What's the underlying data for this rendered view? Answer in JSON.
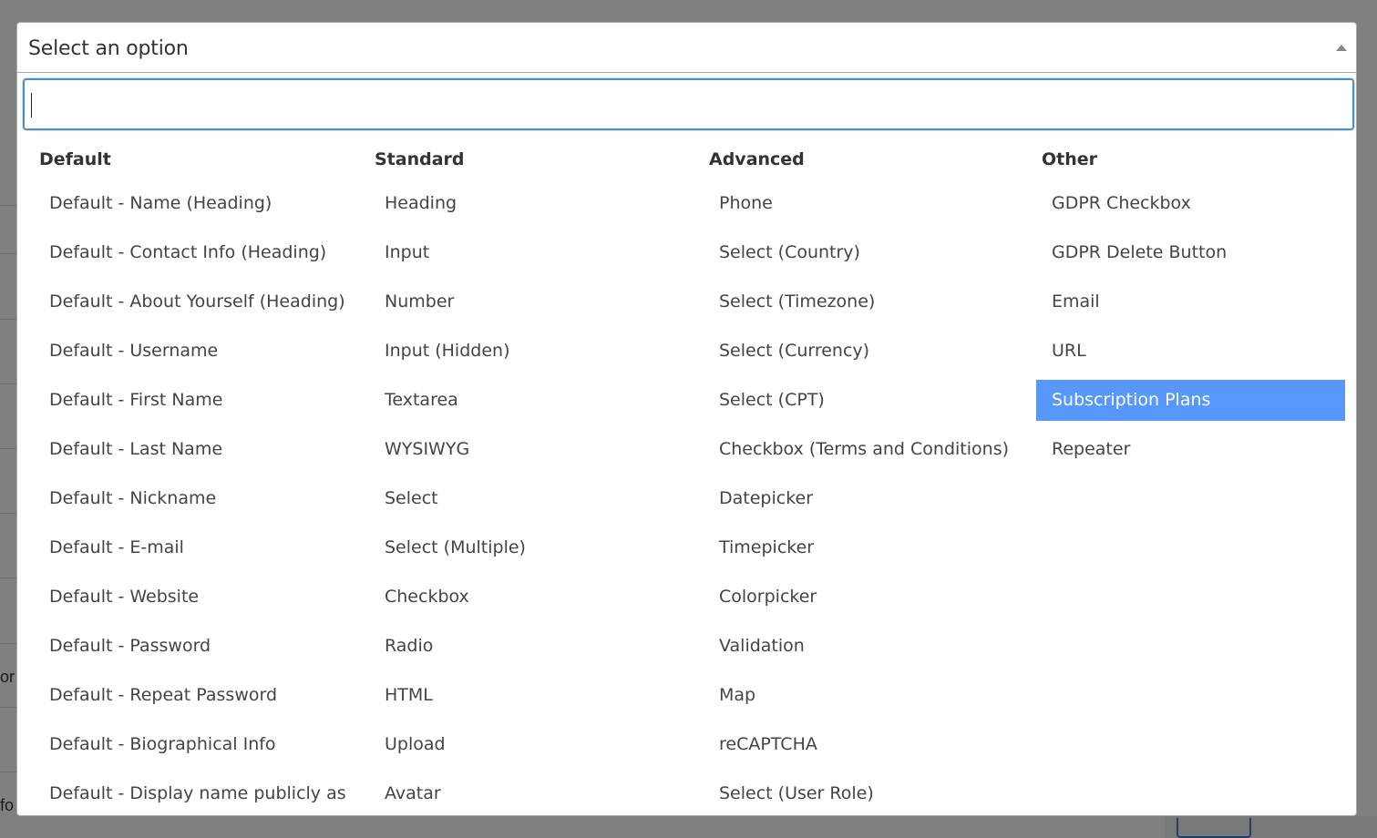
{
  "select": {
    "placeholder": "Select an option",
    "search_value": ""
  },
  "groups": [
    {
      "title": "Default",
      "options": [
        "Default - Name (Heading)",
        "Default - Contact Info (Heading)",
        "Default - About Yourself (Heading)",
        "Default - Username",
        "Default - First Name",
        "Default - Last Name",
        "Default - Nickname",
        "Default - E-mail",
        "Default - Website",
        "Default - Password",
        "Default - Repeat Password",
        "Default - Biographical Info",
        "Default - Display name publicly as"
      ]
    },
    {
      "title": "Standard",
      "options": [
        "Heading",
        "Input",
        "Number",
        "Input (Hidden)",
        "Textarea",
        "WYSIWYG",
        "Select",
        "Select (Multiple)",
        "Checkbox",
        "Radio",
        "HTML",
        "Upload",
        "Avatar"
      ]
    },
    {
      "title": "Advanced",
      "options": [
        "Phone",
        "Select (Country)",
        "Select (Timezone)",
        "Select (Currency)",
        "Select (CPT)",
        "Checkbox (Terms and Conditions)",
        "Datepicker",
        "Timepicker",
        "Colorpicker",
        "Validation",
        "Map",
        "reCAPTCHA",
        "Select (User Role)"
      ]
    },
    {
      "title": "Other",
      "options": [
        "GDPR Checkbox",
        "GDPR Delete Button",
        "Email",
        "URL",
        "Subscription Plans",
        "Repeater"
      ]
    }
  ],
  "highlighted_option": "Subscription Plans",
  "background_fragments": [
    "or",
    "fo"
  ],
  "colors": {
    "highlight": "#5897fb",
    "search_border": "#4a90c8",
    "overlay": "#808080"
  }
}
